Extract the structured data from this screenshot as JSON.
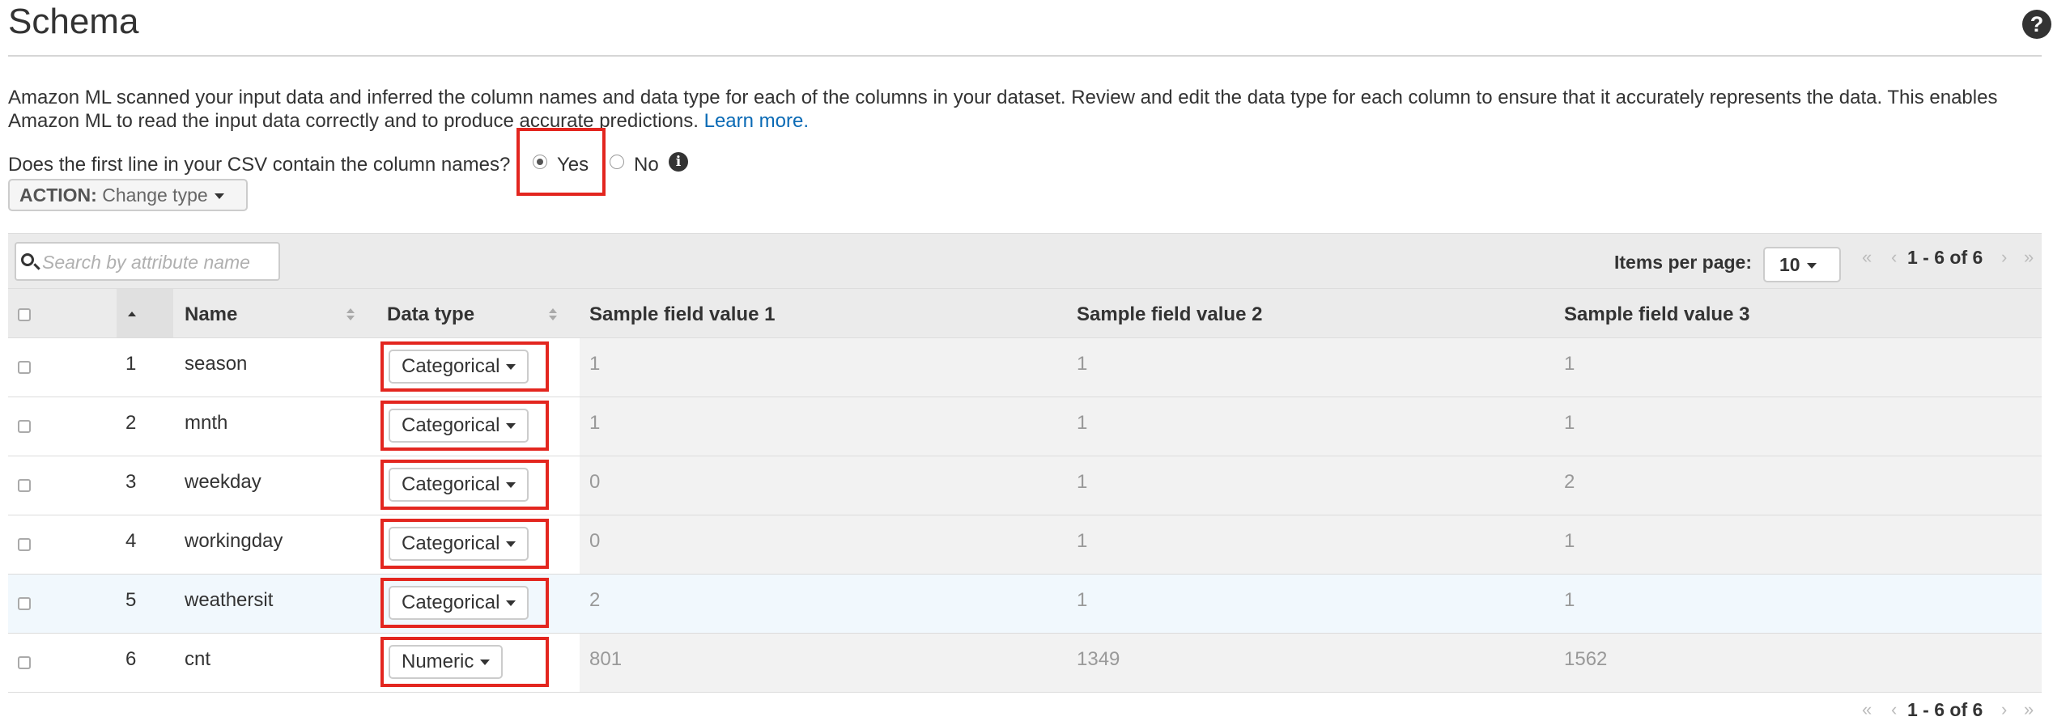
{
  "header": {
    "title": "Schema",
    "help_icon": "?"
  },
  "description": {
    "text": "Amazon ML scanned your input data and inferred the column names and data type for each of the columns in your dataset. Review and edit the data type for each column to ensure that it accurately represents the data. This enables Amazon ML to read the input data correctly and to produce accurate predictions.",
    "link": "Learn more."
  },
  "header_question": {
    "text": "Does the first line in your CSV contain the column names?",
    "options": [
      {
        "label": "Yes",
        "selected": true
      },
      {
        "label": "No",
        "selected": false
      }
    ],
    "info_icon": "i"
  },
  "action": {
    "label": "ACTION:",
    "value": "Change type"
  },
  "toolbar": {
    "search_placeholder": "Search by attribute name",
    "items_per_page_label": "Items per page:",
    "items_per_page": "10",
    "pager_first": "«",
    "pager_prev": "‹",
    "range": "1 - 6 of 6",
    "pager_next": "›",
    "pager_last": "»"
  },
  "table": {
    "headers": {
      "name": "Name",
      "data_type": "Data type",
      "sample1": "Sample field value 1",
      "sample2": "Sample field value 2",
      "sample3": "Sample field value 3"
    },
    "rows": [
      {
        "index": "1",
        "name": "season",
        "type": "Categorical",
        "s1": "1",
        "s2": "1",
        "s3": "1"
      },
      {
        "index": "2",
        "name": "mnth",
        "type": "Categorical",
        "s1": "1",
        "s2": "1",
        "s3": "1"
      },
      {
        "index": "3",
        "name": "weekday",
        "type": "Categorical",
        "s1": "0",
        "s2": "1",
        "s3": "2"
      },
      {
        "index": "4",
        "name": "workingday",
        "type": "Categorical",
        "s1": "0",
        "s2": "1",
        "s3": "1"
      },
      {
        "index": "5",
        "name": "weathersit",
        "type": "Categorical",
        "s1": "2",
        "s2": "1",
        "s3": "1"
      },
      {
        "index": "6",
        "name": "cnt",
        "type": "Numeric",
        "s1": "801",
        "s2": "1349",
        "s3": "1562"
      }
    ]
  },
  "bottom_pager": {
    "first": "«",
    "prev": "‹",
    "range": "1 - 6 of 6",
    "next": "›",
    "last": "»"
  },
  "colors": {
    "highlight": "#e3261f",
    "link": "#0a6ab5",
    "selected_row": "#f1f8fd"
  }
}
